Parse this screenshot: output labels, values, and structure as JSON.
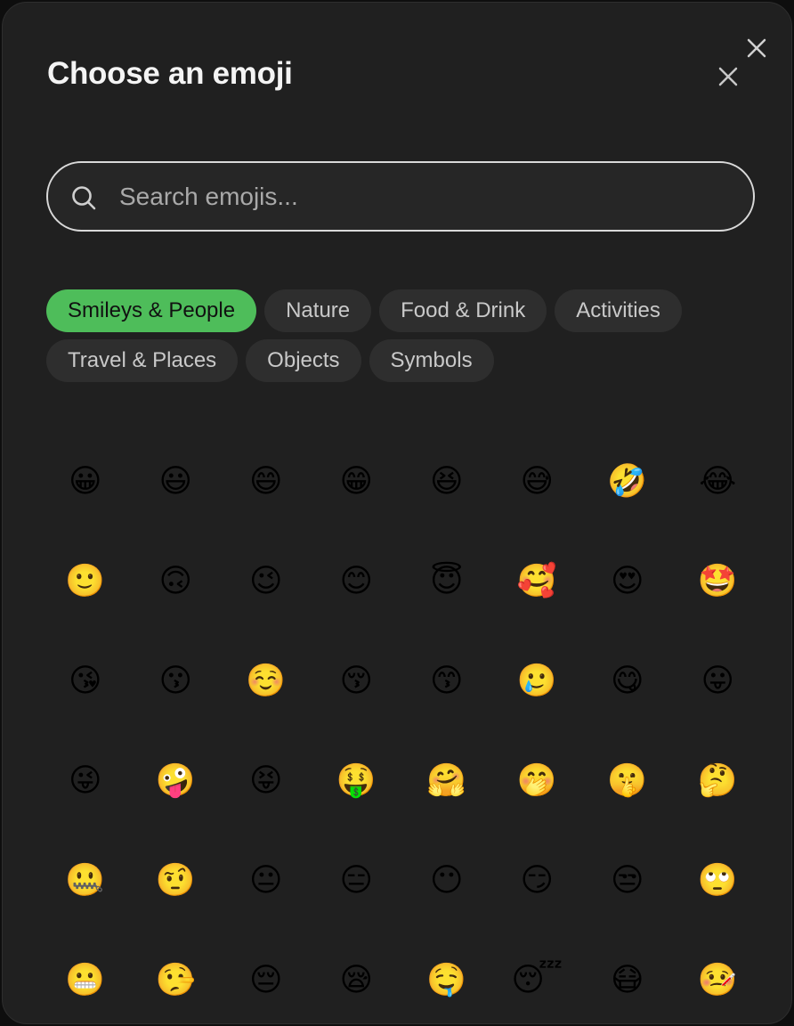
{
  "dialog": {
    "title": "Choose an emoji",
    "close_icon": "close-icon"
  },
  "search": {
    "icon": "search-icon",
    "placeholder": "Search emojis...",
    "value": ""
  },
  "tabs": [
    {
      "label": "Smileys & People",
      "active": true
    },
    {
      "label": "Nature",
      "active": false
    },
    {
      "label": "Food & Drink",
      "active": false
    },
    {
      "label": "Activities",
      "active": false
    },
    {
      "label": "Travel & Places",
      "active": false
    },
    {
      "label": "Objects",
      "active": false
    },
    {
      "label": "Symbols",
      "active": false
    }
  ],
  "colors": {
    "accent": "#4ebd5a",
    "background": "#202020",
    "chip": "#2e2e2e"
  },
  "emojis": [
    "😀",
    "😃",
    "😄",
    "😁",
    "😆",
    "😅",
    "🤣",
    "😂",
    "🙂",
    "🙃",
    "😉",
    "😊",
    "😇",
    "🥰",
    "😍",
    "🤩",
    "😘",
    "😗",
    "☺️",
    "😚",
    "😙",
    "🥲",
    "😋",
    "😛",
    "😜",
    "🤪",
    "😝",
    "🤑",
    "🤗",
    "🤭",
    "🤫",
    "🤔",
    "🤐",
    "🤨",
    "😐",
    "😑",
    "😶",
    "😏",
    "😒",
    "🙄",
    "😬",
    "🤥",
    "😔",
    "😪",
    "🤤",
    "😴",
    "😷",
    "🤒"
  ]
}
